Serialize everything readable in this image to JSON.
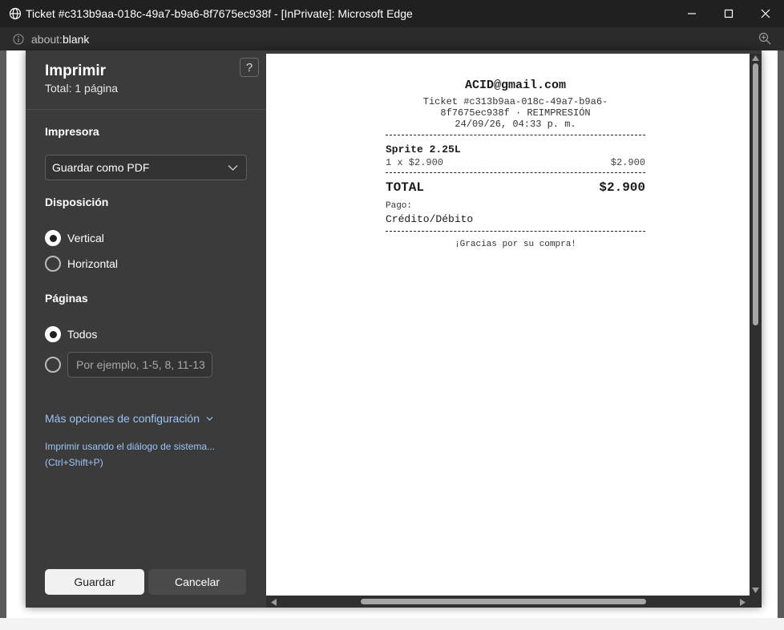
{
  "window": {
    "title": "Ticket #c313b9aa-018c-49a7-b9a6-8f7675ec938f - [InPrivate]: Microsoft Edge",
    "url_prefix": "about:",
    "url_main": "blank"
  },
  "print_panel": {
    "title": "Imprimir",
    "total": "Total: 1 página",
    "help_label": "?",
    "printer": {
      "label": "Impresora",
      "selected": "Guardar como PDF"
    },
    "layout": {
      "label": "Disposición",
      "options": [
        "Vertical",
        "Horizontal"
      ],
      "selected": "Vertical"
    },
    "pages": {
      "label": "Páginas",
      "all_label": "Todos",
      "custom_placeholder": "Por ejemplo, 1-5, 8, 11-13",
      "selected": "Todos"
    },
    "more_settings": "Más opciones de configuración",
    "system_dialog": "Imprimir usando el diálogo de sistema...",
    "system_dialog_shortcut": "(Ctrl+Shift+P)",
    "save_label": "Guardar",
    "cancel_label": "Cancelar"
  },
  "receipt": {
    "email": "ACID@gmail.com",
    "ticket_line1": "Ticket #c313b9aa-018c-49a7-b9a6-",
    "ticket_line2": "8f7675ec938f · REIMPRESIÓN",
    "datetime": "24/09/26, 04:33 p. m.",
    "item_name": "Sprite 2.25L",
    "item_qty_price": "1 x $2.900",
    "item_amount": "$2.900",
    "total_label": "TOTAL",
    "total_amount": "$2.900",
    "payment_label": "Pago:",
    "payment_method": "Crédito/Débito",
    "thanks": "¡Gracias por su compra!"
  }
}
